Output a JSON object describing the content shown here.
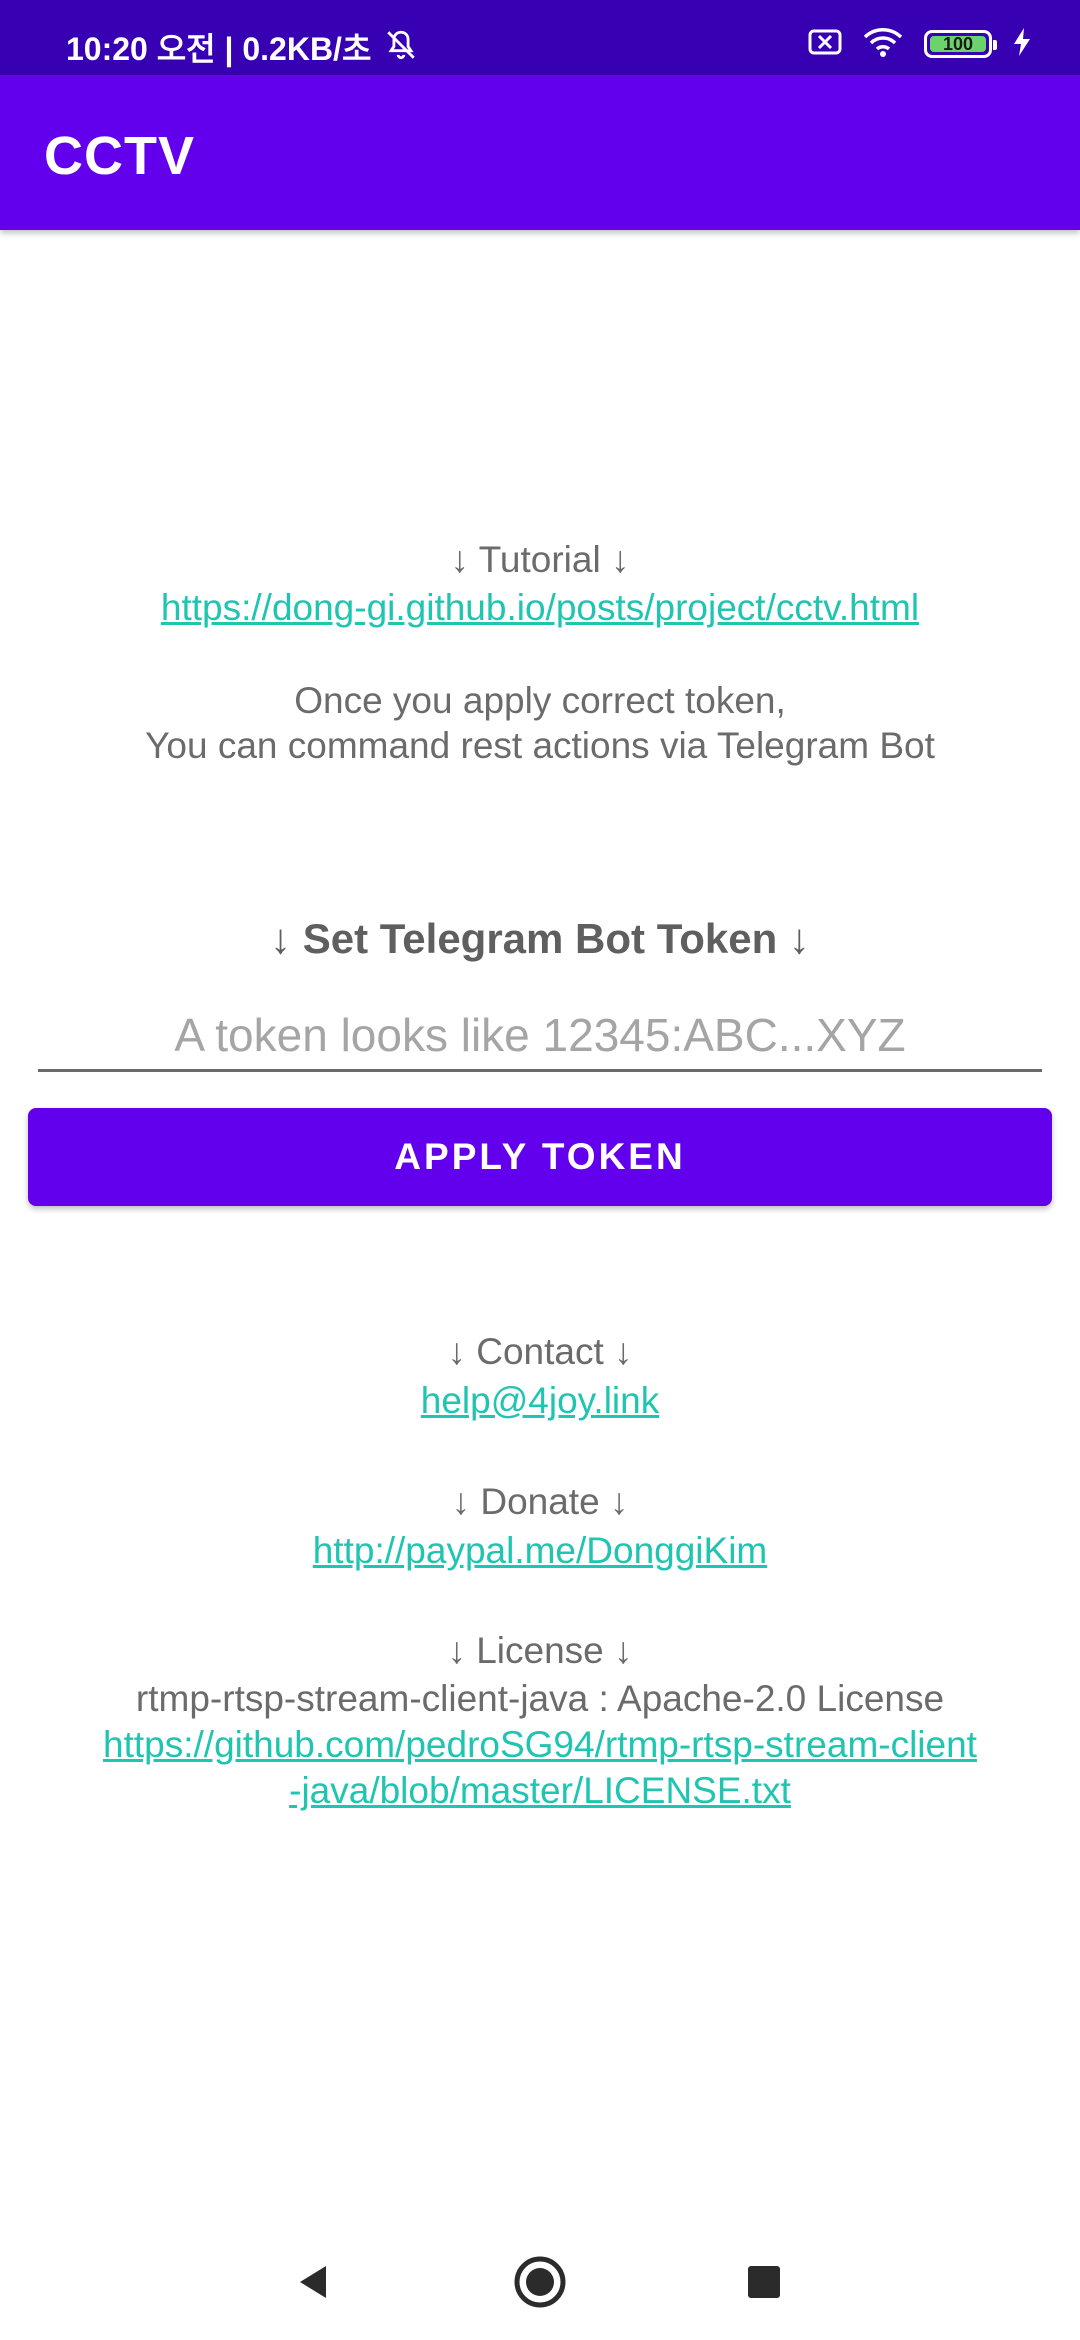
{
  "status_bar": {
    "time": "10:20 오전 | 0.2KB/초",
    "battery_level": "100"
  },
  "app_bar": {
    "title": "CCTV"
  },
  "tutorial": {
    "heading": "↓ Tutorial ↓",
    "link": "https://dong-gi.github.io/posts/project/cctv.html",
    "note_line1": "Once you apply correct token,",
    "note_line2": "You can command rest actions via Telegram Bot"
  },
  "token": {
    "heading": "↓ Set Telegram Bot Token ↓",
    "placeholder": "A token looks like 12345:ABC...XYZ",
    "value": "",
    "button_label": "APPLY TOKEN"
  },
  "contact": {
    "heading": "↓ Contact ↓",
    "link": "help@4joy.link"
  },
  "donate": {
    "heading": "↓ Donate ↓",
    "link": "http://paypal.me/DonggiKim"
  },
  "license": {
    "heading": "↓ License ↓",
    "text": "rtmp-rtsp-stream-client-java : Apache-2.0 License",
    "link_line1": "https://github.com/pedroSG94/rtmp-rtsp-stream-client",
    "link_line2": "-java/blob/master/LICENSE.txt"
  },
  "colors": {
    "status_bar": "#3700B3",
    "primary": "#6200EE",
    "link": "#1fc5b0",
    "text": "#6b6b6b"
  },
  "icons": [
    "mute-icon",
    "sim-off-icon",
    "wifi-icon",
    "battery-icon",
    "charging-icon",
    "back-icon",
    "home-icon",
    "recents-icon"
  ]
}
